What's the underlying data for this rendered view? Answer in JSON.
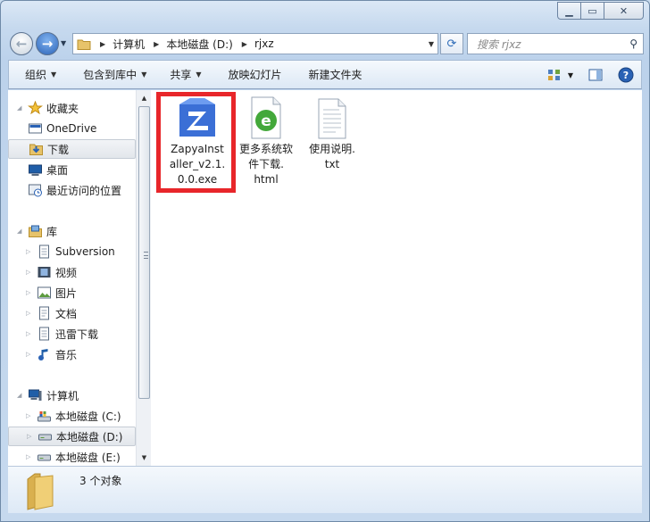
{
  "address": {
    "crumbs": [
      "计算机",
      "本地磁盘 (D:)",
      "rjxz"
    ]
  },
  "search": {
    "placeholder": "搜索 rjxz"
  },
  "toolbar": {
    "organize": "组织",
    "include_in_library": "包含到库中",
    "share": "共享",
    "slideshow": "放映幻灯片",
    "new_folder": "新建文件夹"
  },
  "navpane": {
    "favorites": "收藏夹",
    "onedrive": "OneDrive",
    "downloads": "下载",
    "desktop": "桌面",
    "recent": "最近访问的位置",
    "libraries": "库",
    "subversion": "Subversion",
    "videos": "视频",
    "pictures": "图片",
    "documents": "文档",
    "thunder": "迅雷下载",
    "music": "音乐",
    "computer": "计算机",
    "drive_c": "本地磁盘 (C:)",
    "drive_d": "本地磁盘 (D:)",
    "drive_e": "本地磁盘 (E:)"
  },
  "files": [
    {
      "name": "ZapyaInstaller_v2.1.0.0.exe",
      "lines": [
        "ZapyaInst",
        "aller_v2.1.",
        "0.0.exe"
      ]
    },
    {
      "name": "更多系统软件下载.html",
      "lines": [
        "更多系统软",
        "件下载.",
        "html"
      ]
    },
    {
      "name": "使用说明.txt",
      "lines": [
        "使用说明.",
        "txt"
      ]
    }
  ],
  "status": {
    "count": "3 个对象"
  },
  "colors": {
    "highlight": "#e8262a",
    "accent": "#2c64b8"
  }
}
